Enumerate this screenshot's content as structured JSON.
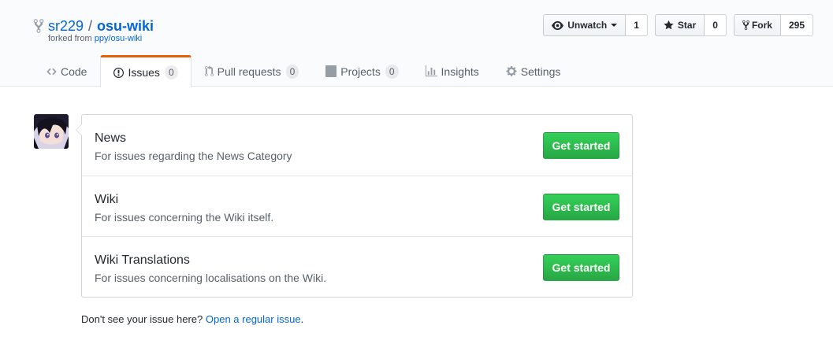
{
  "repo": {
    "owner": "sr229",
    "separator": "/",
    "name": "osu-wiki",
    "forked_from_prefix": "forked from",
    "forked_from_link": "ppy/osu-wiki"
  },
  "actions": {
    "watch": {
      "label": "Unwatch",
      "count": "1"
    },
    "star": {
      "label": "Star",
      "count": "0"
    },
    "fork": {
      "label": "Fork",
      "count": "295"
    }
  },
  "nav": [
    {
      "label": "Code",
      "icon": "code-icon"
    },
    {
      "label": "Issues",
      "icon": "issue-opened-icon",
      "counter": "0",
      "selected": true
    },
    {
      "label": "Pull requests",
      "icon": "git-pull-request-icon",
      "counter": "0"
    },
    {
      "label": "Projects",
      "icon": "project-icon",
      "counter": "0"
    },
    {
      "label": "Insights",
      "icon": "graph-icon"
    },
    {
      "label": "Settings",
      "icon": "gear-icon"
    }
  ],
  "templates": [
    {
      "name": "News",
      "description": "For issues regarding the News Category",
      "button": "Get started"
    },
    {
      "name": "Wiki",
      "description": "For issues concerning the Wiki itself.",
      "button": "Get started"
    },
    {
      "name": "Wiki Translations",
      "description": "For issues concerning localisations on the Wiki.",
      "button": "Get started"
    }
  ],
  "footer": {
    "prefix": "Don't see your issue here?",
    "link": "Open a regular issue",
    "suffix": "."
  },
  "colors": {
    "link": "#0366d6",
    "primary_button": "#28a745",
    "selected_tab_accent": "#e36209"
  }
}
